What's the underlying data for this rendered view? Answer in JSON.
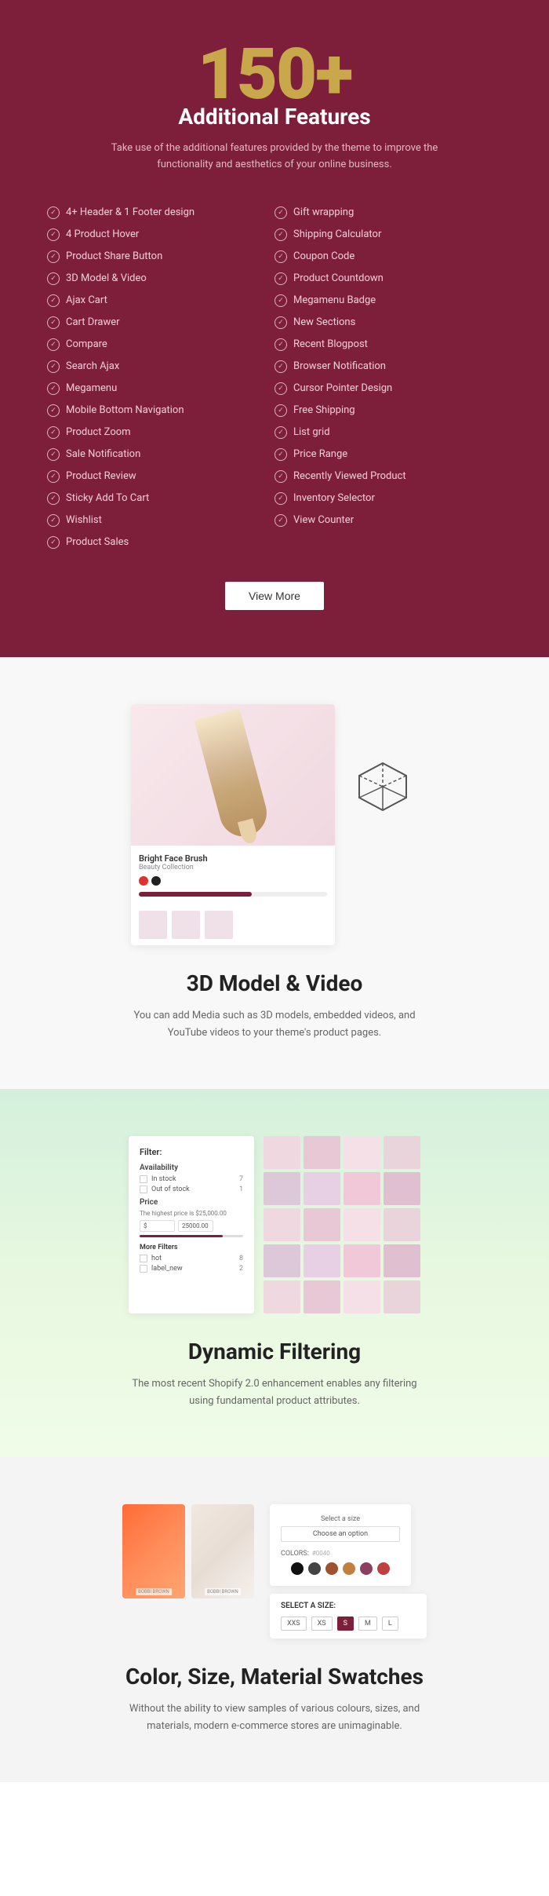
{
  "features": {
    "hero_number": "150+",
    "title": "Additional Features",
    "subtitle": "Take use of the additional features provided by the theme to improve the functionality and aesthetics of your online business.",
    "col1": [
      "4+ Header & 1 Footer design",
      "4 Product Hover",
      "Product Share Button",
      "3D Model & Video",
      "Ajax Cart",
      "Cart Drawer",
      "Compare",
      "Search Ajax",
      "Megamenu",
      "Mobile Bottom Navigation",
      "Product Zoom",
      "Sale Notification",
      "Product Review",
      "Sticky Add To Cart",
      "Wishlist",
      "Product Sales"
    ],
    "col2": [
      "Gift wrapping",
      "Shipping Calculator",
      "Coupon Code",
      "Product Countdown",
      "Megamenu Badge",
      "New Sections",
      "Recent Blogpost",
      "Browser Notification",
      "Cursor Pointer Design",
      "Free Shipping",
      "List grid",
      "Price Range",
      "Recently Viewed Product",
      "Inventory Selector",
      "View Counter"
    ],
    "view_more": "View More"
  },
  "model_section": {
    "title": "3D Model & Video",
    "description": "You can add Media such as 3D models, embedded videos, and YouTube videos to your theme's product pages.",
    "product_name": "Bright Face Brush",
    "product_sub": "Beauty Collection"
  },
  "filter_section": {
    "title": "Dynamic Filtering",
    "description": "The most recent Shopify 2.0 enhancement enables any filtering using fundamental product attributes.",
    "panel_title": "Filter:",
    "availability_label": "Availability",
    "in_stock": "In stock",
    "in_stock_count": "7",
    "out_of_stock": "Out of stock",
    "out_of_stock_count": "1",
    "price_label": "Price",
    "price_text": "The highest price is $25,000.00",
    "price_from": "$",
    "price_to": "25000.00",
    "more_filters": "More Filters",
    "tag_label": "hot",
    "tag_count": "8",
    "label_new": "label_new",
    "label_new_count": "2"
  },
  "swatches_section": {
    "title": "Color, Size, Material Swatches",
    "description": "Without the ability to view samples of various colours, sizes, and materials, modern e-commerce stores are unimaginable.",
    "size_label": "Select a size",
    "choose_option": "Choose an option",
    "colors_label": "COLORS:",
    "colors_code": "#0040",
    "colors": [
      "#111",
      "#444",
      "#a0522d",
      "#c08040",
      "#8b4060",
      "#c04040"
    ],
    "size_select_label": "SELECT A SIZE:",
    "sizes": [
      "XXS",
      "XS",
      "S",
      "M",
      "L"
    ],
    "active_size": "S"
  }
}
